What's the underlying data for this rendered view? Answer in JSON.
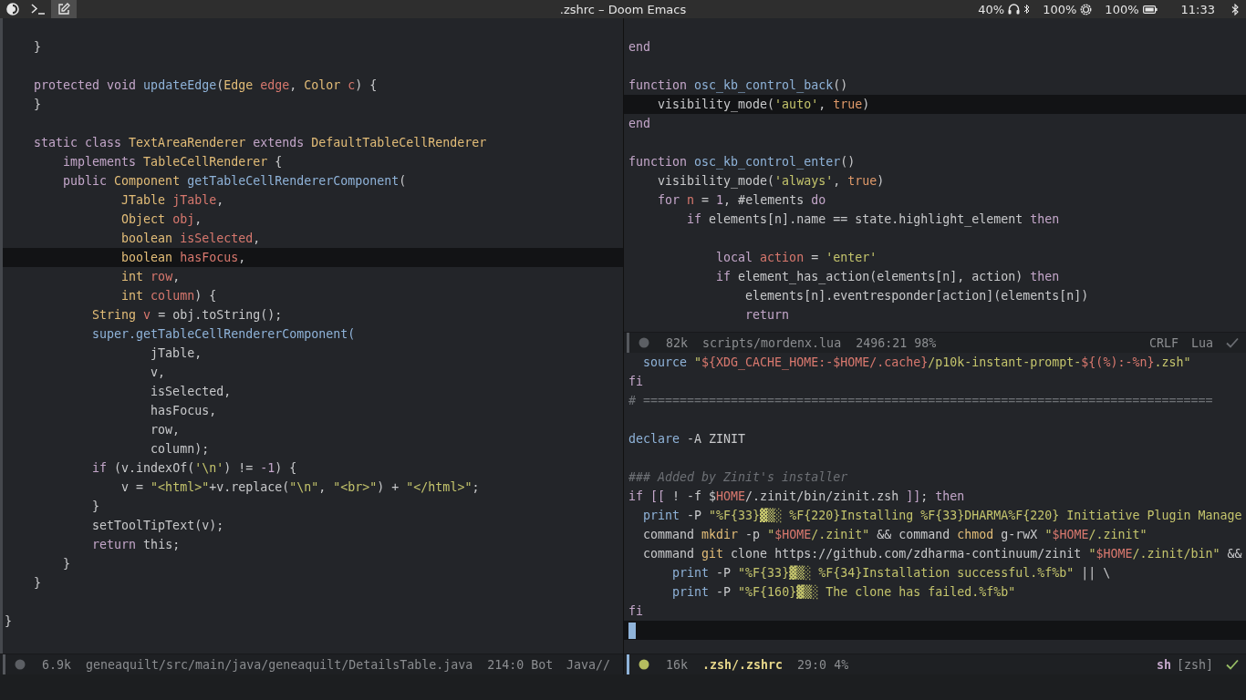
{
  "top_bar": {
    "launchers": [
      {
        "kind": "theme",
        "selected": false
      },
      {
        "kind": "terminal",
        "selected": false
      },
      {
        "kind": "editor",
        "selected": true
      }
    ],
    "title": ".zshrc – Doom Emacs",
    "indicators": [
      {
        "kind": "headset",
        "text": "40%"
      },
      {
        "kind": "brightness",
        "text": "100%"
      },
      {
        "kind": "battery",
        "text": "100%"
      }
    ],
    "clock": "11:33"
  },
  "columns": [
    {
      "windows": [
        {
          "active": false,
          "lines": [
            {
              "current": false
            },
            {
              "current": false,
              "tokens": [
                {
                  "kind": "plain",
                  "text": "    }"
                }
              ]
            },
            {
              "current": false
            },
            {
              "current": false,
              "tokens": [
                {
                  "kind": "kw",
                  "text": "    protected void"
                },
                {
                  "kind": "fn",
                  "text": " updateEdge"
                },
                {
                  "kind": "plain",
                  "text": "("
                },
                {
                  "kind": "type",
                  "text": "Edge"
                },
                {
                  "kind": "var",
                  "text": " edge"
                },
                {
                  "kind": "plain",
                  "text": ","
                },
                {
                  "kind": "type",
                  "text": " Color"
                },
                {
                  "kind": "var",
                  "text": " c"
                },
                {
                  "kind": "plain",
                  "text": ") {"
                }
              ]
            },
            {
              "current": false,
              "tokens": [
                {
                  "kind": "plain",
                  "text": "    }"
                }
              ]
            },
            {
              "current": false
            },
            {
              "current": false,
              "tokens": [
                {
                  "kind": "kw",
                  "text": "    static class"
                },
                {
                  "kind": "type",
                  "text": " TextAreaRenderer"
                },
                {
                  "kind": "kw",
                  "text": " extends"
                },
                {
                  "kind": "type",
                  "text": " DefaultTableCellRenderer"
                }
              ]
            },
            {
              "current": false,
              "tokens": [
                {
                  "kind": "kw",
                  "text": "        implements"
                },
                {
                  "kind": "type",
                  "text": " TableCellRenderer"
                },
                {
                  "kind": "plain",
                  "text": " {"
                }
              ]
            },
            {
              "current": false,
              "tokens": [
                {
                  "kind": "kw",
                  "text": "        public"
                },
                {
                  "kind": "type",
                  "text": " Component"
                },
                {
                  "kind": "fn",
                  "text": " getTableCellRendererComponent"
                },
                {
                  "kind": "plain",
                  "text": "("
                }
              ]
            },
            {
              "current": false,
              "tokens": [
                {
                  "kind": "type",
                  "text": "                JTable"
                },
                {
                  "kind": "var",
                  "text": " jTable"
                },
                {
                  "kind": "plain",
                  "text": ","
                }
              ]
            },
            {
              "current": false,
              "tokens": [
                {
                  "kind": "type",
                  "text": "                Object"
                },
                {
                  "kind": "var",
                  "text": " obj"
                },
                {
                  "kind": "plain",
                  "text": ","
                }
              ]
            },
            {
              "current": false,
              "tokens": [
                {
                  "kind": "type",
                  "text": "                boolean"
                },
                {
                  "kind": "var",
                  "text": " isSelected"
                },
                {
                  "kind": "plain",
                  "text": ","
                }
              ]
            },
            {
              "current": true,
              "tokens": [
                {
                  "kind": "type",
                  "text": "                boolean"
                },
                {
                  "kind": "var",
                  "text": " hasFocus"
                },
                {
                  "kind": "plain",
                  "text": ","
                }
              ]
            },
            {
              "current": false,
              "tokens": [
                {
                  "kind": "type",
                  "text": "                int"
                },
                {
                  "kind": "var",
                  "text": " row"
                },
                {
                  "kind": "plain",
                  "text": ","
                }
              ]
            },
            {
              "current": false,
              "tokens": [
                {
                  "kind": "type",
                  "text": "                int"
                },
                {
                  "kind": "var",
                  "text": " column"
                },
                {
                  "kind": "plain",
                  "text": ") {"
                }
              ]
            },
            {
              "current": false,
              "tokens": [
                {
                  "kind": "type",
                  "text": "            String"
                },
                {
                  "kind": "var",
                  "text": " v"
                },
                {
                  "kind": "plain",
                  "text": " = obj.toString();"
                }
              ]
            },
            {
              "current": false,
              "tokens": [
                {
                  "kind": "fn",
                  "text": "            super.getTableCellRendererComponent("
                }
              ]
            },
            {
              "current": false,
              "tokens": [
                {
                  "kind": "plain",
                  "text": "                    jTable,"
                }
              ]
            },
            {
              "current": false,
              "tokens": [
                {
                  "kind": "plain",
                  "text": "                    v,"
                }
              ]
            },
            {
              "current": false,
              "tokens": [
                {
                  "kind": "plain",
                  "text": "                    isSelected,"
                }
              ]
            },
            {
              "current": false,
              "tokens": [
                {
                  "kind": "plain",
                  "text": "                    hasFocus,"
                }
              ]
            },
            {
              "current": false,
              "tokens": [
                {
                  "kind": "plain",
                  "text": "                    row,"
                }
              ]
            },
            {
              "current": false,
              "tokens": [
                {
                  "kind": "plain",
                  "text": "                    column);"
                }
              ]
            },
            {
              "current": false,
              "tokens": [
                {
                  "kind": "kw",
                  "text": "            if"
                },
                {
                  "kind": "plain",
                  "text": " (v.indexOf("
                },
                {
                  "kind": "str",
                  "text": "'\\n'"
                },
                {
                  "kind": "plain",
                  "text": ") != "
                },
                {
                  "kind": "num",
                  "text": "-1"
                },
                {
                  "kind": "plain",
                  "text": ") {"
                }
              ]
            },
            {
              "current": false,
              "tokens": [
                {
                  "kind": "plain",
                  "text": "                v = "
                },
                {
                  "kind": "str",
                  "text": "\"<html>\""
                },
                {
                  "kind": "plain",
                  "text": "+v.replace("
                },
                {
                  "kind": "str",
                  "text": "\"\\n\""
                },
                {
                  "kind": "plain",
                  "text": ","
                },
                {
                  "kind": "str",
                  "text": " \"<br>\""
                },
                {
                  "kind": "plain",
                  "text": ") + "
                },
                {
                  "kind": "str",
                  "text": "\"</html>\""
                },
                {
                  "kind": "plain",
                  "text": ";"
                }
              ]
            },
            {
              "current": false,
              "tokens": [
                {
                  "kind": "plain",
                  "text": "            }"
                }
              ]
            },
            {
              "current": false,
              "tokens": [
                {
                  "kind": "plain",
                  "text": "            setToolTipText(v);"
                }
              ]
            },
            {
              "current": false,
              "tokens": [
                {
                  "kind": "kw",
                  "text": "            return"
                },
                {
                  "kind": "plain",
                  "text": " this;"
                }
              ]
            },
            {
              "current": false,
              "tokens": [
                {
                  "kind": "plain",
                  "text": "        }"
                }
              ]
            },
            {
              "current": false,
              "tokens": [
                {
                  "kind": "plain",
                  "text": "    }"
                }
              ]
            },
            {
              "current": false
            },
            {
              "current": false,
              "tokens": [
                {
                  "kind": "plain",
                  "text": "}"
                }
              ]
            }
          ],
          "modeline": {
            "size": "6.9k",
            "file": "geneaquilt/src/main/java/geneaquilt/DetailsTable.java",
            "position": "214:0",
            "scroll": "Bot",
            "segments": [
              {
                "kind": "plain",
                "text": "Java//"
              }
            ],
            "checker": false
          }
        }
      ]
    },
    {
      "windows": [
        {
          "active": false,
          "lines": [
            {
              "current": false
            },
            {
              "current": false,
              "tokens": [
                {
                  "kind": "kw",
                  "text": "end"
                }
              ]
            },
            {
              "current": false
            },
            {
              "current": false,
              "tokens": [
                {
                  "kind": "kw",
                  "text": "function"
                },
                {
                  "kind": "fn",
                  "text": " osc_kb_control_back"
                },
                {
                  "kind": "plain",
                  "text": "()"
                }
              ]
            },
            {
              "current": true,
              "tokens": [
                {
                  "kind": "plain",
                  "text": "    visibility_mode("
                },
                {
                  "kind": "str",
                  "text": "'auto'"
                },
                {
                  "kind": "plain",
                  "text": ","
                },
                {
                  "kind": "const",
                  "text": " true"
                },
                {
                  "kind": "plain",
                  "text": ")"
                }
              ]
            },
            {
              "current": false,
              "tokens": [
                {
                  "kind": "kw",
                  "text": "end"
                }
              ]
            },
            {
              "current": false
            },
            {
              "current": false,
              "tokens": [
                {
                  "kind": "kw",
                  "text": "function"
                },
                {
                  "kind": "fn",
                  "text": " osc_kb_control_enter"
                },
                {
                  "kind": "plain",
                  "text": "()"
                }
              ]
            },
            {
              "current": false,
              "tokens": [
                {
                  "kind": "plain",
                  "text": "    visibility_mode("
                },
                {
                  "kind": "str",
                  "text": "'always'"
                },
                {
                  "kind": "plain",
                  "text": ","
                },
                {
                  "kind": "const",
                  "text": " true"
                },
                {
                  "kind": "plain",
                  "text": ")"
                }
              ]
            },
            {
              "current": false,
              "tokens": [
                {
                  "kind": "kw",
                  "text": "    for"
                },
                {
                  "kind": "var",
                  "text": " n"
                },
                {
                  "kind": "plain",
                  "text": " = "
                },
                {
                  "kind": "num",
                  "text": "1"
                },
                {
                  "kind": "plain",
                  "text": ", #elements "
                },
                {
                  "kind": "kw",
                  "text": "do"
                }
              ]
            },
            {
              "current": false,
              "tokens": [
                {
                  "kind": "kw",
                  "text": "        if"
                },
                {
                  "kind": "plain",
                  "text": " elements[n].name == state.highlight_element "
                },
                {
                  "kind": "kw",
                  "text": "then"
                }
              ]
            },
            {
              "current": false
            },
            {
              "current": false,
              "tokens": [
                {
                  "kind": "kw",
                  "text": "            local"
                },
                {
                  "kind": "var",
                  "text": " action"
                },
                {
                  "kind": "plain",
                  "text": " = "
                },
                {
                  "kind": "str",
                  "text": "'enter'"
                }
              ]
            },
            {
              "current": false,
              "tokens": [
                {
                  "kind": "kw",
                  "text": "            if"
                },
                {
                  "kind": "plain",
                  "text": " element_has_action(elements[n], action) "
                },
                {
                  "kind": "kw",
                  "text": "then"
                }
              ]
            },
            {
              "current": false,
              "tokens": [
                {
                  "kind": "plain",
                  "text": "                elements[n].eventresponder[action](elements[n])"
                }
              ]
            },
            {
              "current": false,
              "tokens": [
                {
                  "kind": "kw",
                  "text": "                return"
                }
              ]
            }
          ],
          "modeline": {
            "size": "82k",
            "file": "scripts/mordenx.lua",
            "position": "2496:21",
            "scroll": "98%",
            "segments": [
              {
                "kind": "plain",
                "text": "CRLF"
              },
              {
                "kind": "plain",
                "text": "Lua"
              }
            ],
            "checker": true
          }
        },
        {
          "active": true,
          "lines": [
            {
              "current": false,
              "tokens": [
                {
                  "kind": "fn",
                  "text": "  source"
                },
                {
                  "kind": "str",
                  "text": " \""
                },
                {
                  "kind": "var",
                  "text": "${XDG_CACHE_HOME:-$HOME/.cache}"
                },
                {
                  "kind": "str",
                  "text": "/p10k-instant-prompt-"
                },
                {
                  "kind": "var",
                  "text": "${(%):-%n}"
                },
                {
                  "kind": "str",
                  "text": ".zsh\""
                }
              ]
            },
            {
              "current": false,
              "tokens": [
                {
                  "kind": "kw",
                  "text": "fi"
                }
              ]
            },
            {
              "current": false,
              "tokens": [
                {
                  "kind": "comment",
                  "text": "# =============================================================================="
                }
              ]
            },
            {
              "current": false
            },
            {
              "current": false,
              "tokens": [
                {
                  "kind": "fn",
                  "text": "declare"
                },
                {
                  "kind": "plain",
                  "text": " -A ZINIT"
                }
              ]
            },
            {
              "current": false
            },
            {
              "current": false,
              "tokens": [
                {
                  "kind": "comment_italic",
                  "text": "### Added by Zinit's installer"
                }
              ]
            },
            {
              "current": false,
              "tokens": [
                {
                  "kind": "kw",
                  "text": "if [["
                },
                {
                  "kind": "plain",
                  "text": " ! -f $"
                },
                {
                  "kind": "var",
                  "text": "HOME"
                },
                {
                  "kind": "plain",
                  "text": "/.zinit/bin/zinit.zsh "
                },
                {
                  "kind": "kw",
                  "text": "]]"
                },
                {
                  "kind": "plain",
                  "text": "; "
                },
                {
                  "kind": "kw",
                  "text": "then"
                }
              ]
            },
            {
              "current": false,
              "tokens": [
                {
                  "kind": "fn",
                  "text": "  print"
                },
                {
                  "kind": "plain",
                  "text": " -P "
                },
                {
                  "kind": "str",
                  "text": "\"%F{33}▓▒░ %F{220}Installing %F{33}DHARMA%F{220} Initiative Plugin Manage"
                }
              ]
            },
            {
              "current": false,
              "tokens": [
                {
                  "kind": "plain",
                  "text": "  command "
                },
                {
                  "kind": "type",
                  "text": "mkdir"
                },
                {
                  "kind": "plain",
                  "text": " -p "
                },
                {
                  "kind": "str",
                  "text": "\""
                },
                {
                  "kind": "var",
                  "text": "$HOME"
                },
                {
                  "kind": "str",
                  "text": "/.zinit\""
                },
                {
                  "kind": "plain",
                  "text": " && command "
                },
                {
                  "kind": "type",
                  "text": "chmod"
                },
                {
                  "kind": "plain",
                  "text": " g-rwX "
                },
                {
                  "kind": "str",
                  "text": "\""
                },
                {
                  "kind": "var",
                  "text": "$HOME"
                },
                {
                  "kind": "str",
                  "text": "/.zinit\""
                }
              ]
            },
            {
              "current": false,
              "tokens": [
                {
                  "kind": "plain",
                  "text": "  command "
                },
                {
                  "kind": "type",
                  "text": "git"
                },
                {
                  "kind": "plain",
                  "text": " clone https://github.com/zdharma-continuum/zinit "
                },
                {
                  "kind": "str",
                  "text": "\""
                },
                {
                  "kind": "var",
                  "text": "$HOME"
                },
                {
                  "kind": "str",
                  "text": "/.zinit/bin\""
                },
                {
                  "kind": "plain",
                  "text": " &&"
                }
              ]
            },
            {
              "current": false,
              "tokens": [
                {
                  "kind": "fn",
                  "text": "      print"
                },
                {
                  "kind": "plain",
                  "text": " -P "
                },
                {
                  "kind": "str",
                  "text": "\"%F{33}▓▒░ %F{34}Installation successful.%f%b\""
                },
                {
                  "kind": "plain",
                  "text": " || \\"
                }
              ]
            },
            {
              "current": false,
              "tokens": [
                {
                  "kind": "fn",
                  "text": "      print"
                },
                {
                  "kind": "plain",
                  "text": " -P "
                },
                {
                  "kind": "str",
                  "text": "\"%F{160}▓▒░ The clone has failed.%f%b\""
                }
              ]
            },
            {
              "current": false,
              "tokens": [
                {
                  "kind": "kw",
                  "text": "fi"
                }
              ]
            },
            {
              "current": true
            }
          ],
          "modeline": {
            "size": "16k",
            "file": ".zsh/.zshrc",
            "position": "29:0",
            "scroll": "4%",
            "segments": [
              {
                "kind": "mode",
                "text": "sh"
              },
              {
                "kind": "plain",
                "text": "[zsh]"
              }
            ],
            "checker": true
          }
        }
      ]
    }
  ]
}
